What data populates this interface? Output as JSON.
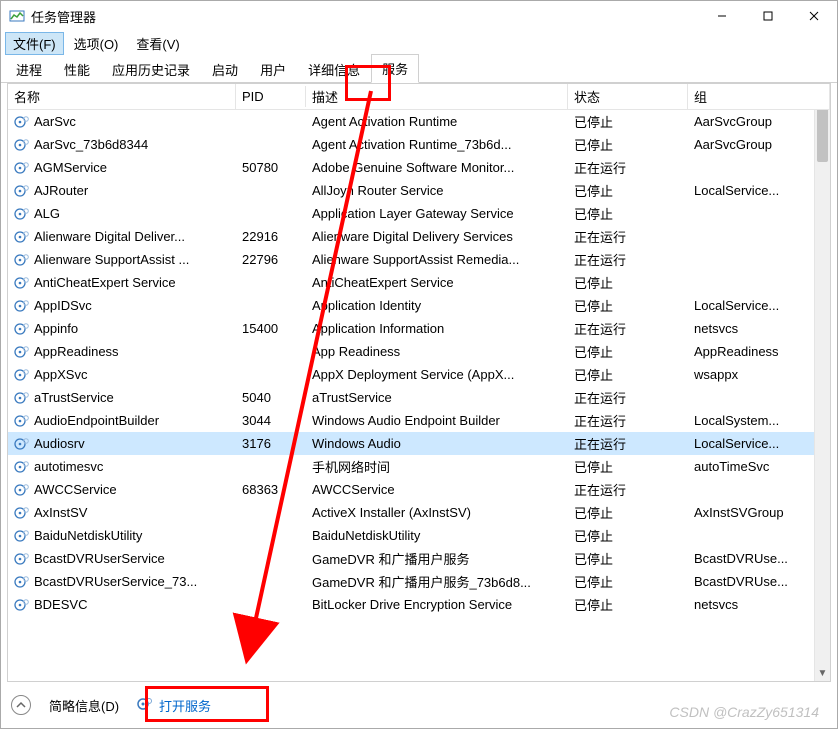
{
  "window": {
    "title": "任务管理器",
    "controls": {
      "min": "–",
      "max": "▢",
      "close": "✕"
    }
  },
  "menu": {
    "items": [
      {
        "label": "文件(F)",
        "active": true
      },
      {
        "label": "选项(O)"
      },
      {
        "label": "查看(V)"
      }
    ]
  },
  "tabs": {
    "items": [
      {
        "label": "进程"
      },
      {
        "label": "性能"
      },
      {
        "label": "应用历史记录"
      },
      {
        "label": "启动"
      },
      {
        "label": "用户"
      },
      {
        "label": "详细信息"
      },
      {
        "label": "服务",
        "active": true
      }
    ]
  },
  "columns": {
    "name": "名称",
    "pid": "PID",
    "desc": "描述",
    "status": "状态",
    "group": "组"
  },
  "services": [
    {
      "name": "AarSvc",
      "pid": "",
      "desc": "Agent Activation Runtime",
      "status": "已停止",
      "group": "AarSvcGroup"
    },
    {
      "name": "AarSvc_73b6d8344",
      "pid": "",
      "desc": "Agent Activation Runtime_73b6d...",
      "status": "已停止",
      "group": "AarSvcGroup"
    },
    {
      "name": "AGMService",
      "pid": "50780",
      "desc": "Adobe Genuine Software Monitor...",
      "status": "正在运行",
      "group": ""
    },
    {
      "name": "AJRouter",
      "pid": "",
      "desc": "AllJoyn Router Service",
      "status": "已停止",
      "group": "LocalService..."
    },
    {
      "name": "ALG",
      "pid": "",
      "desc": "Application Layer Gateway Service",
      "status": "已停止",
      "group": ""
    },
    {
      "name": "Alienware Digital Deliver...",
      "pid": "22916",
      "desc": "Alienware Digital Delivery Services",
      "status": "正在运行",
      "group": ""
    },
    {
      "name": "Alienware SupportAssist ...",
      "pid": "22796",
      "desc": "Alienware SupportAssist Remedia...",
      "status": "正在运行",
      "group": ""
    },
    {
      "name": "AntiCheatExpert Service",
      "pid": "",
      "desc": "AntiCheatExpert Service",
      "status": "已停止",
      "group": ""
    },
    {
      "name": "AppIDSvc",
      "pid": "",
      "desc": "Application Identity",
      "status": "已停止",
      "group": "LocalService..."
    },
    {
      "name": "Appinfo",
      "pid": "15400",
      "desc": "Application Information",
      "status": "正在运行",
      "group": "netsvcs"
    },
    {
      "name": "AppReadiness",
      "pid": "",
      "desc": "App Readiness",
      "status": "已停止",
      "group": "AppReadiness"
    },
    {
      "name": "AppXSvc",
      "pid": "",
      "desc": "AppX Deployment Service (AppX...",
      "status": "已停止",
      "group": "wsappx"
    },
    {
      "name": "aTrustService",
      "pid": "5040",
      "desc": "aTrustService",
      "status": "正在运行",
      "group": ""
    },
    {
      "name": "AudioEndpointBuilder",
      "pid": "3044",
      "desc": "Windows Audio Endpoint Builder",
      "status": "正在运行",
      "group": "LocalSystem..."
    },
    {
      "name": "Audiosrv",
      "pid": "3176",
      "desc": "Windows Audio",
      "status": "正在运行",
      "group": "LocalService...",
      "selected": true
    },
    {
      "name": "autotimesvc",
      "pid": "",
      "desc": "手机网络时间",
      "status": "已停止",
      "group": "autoTimeSvc"
    },
    {
      "name": "AWCCService",
      "pid": "68363",
      "desc": "AWCCService",
      "status": "正在运行",
      "group": ""
    },
    {
      "name": "AxInstSV",
      "pid": "",
      "desc": "ActiveX Installer (AxInstSV)",
      "status": "已停止",
      "group": "AxInstSVGroup"
    },
    {
      "name": "BaiduNetdiskUtility",
      "pid": "",
      "desc": "BaiduNetdiskUtility",
      "status": "已停止",
      "group": ""
    },
    {
      "name": "BcastDVRUserService",
      "pid": "",
      "desc": "GameDVR 和广播用户服务",
      "status": "已停止",
      "group": "BcastDVRUse..."
    },
    {
      "name": "BcastDVRUserService_73...",
      "pid": "",
      "desc": "GameDVR 和广播用户服务_73b6d8...",
      "status": "已停止",
      "group": "BcastDVRUse..."
    },
    {
      "name": "BDESVC",
      "pid": "",
      "desc": "BitLocker Drive Encryption Service",
      "status": "已停止",
      "group": "netsvcs"
    }
  ],
  "footer": {
    "less_details": "简略信息(D)",
    "open_services": "打开服务"
  },
  "watermark": "CSDN @CrazZy651314"
}
